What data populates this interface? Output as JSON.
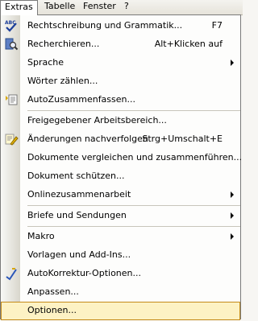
{
  "menubar": {
    "items": [
      "Extras",
      "Tabelle",
      "Fenster",
      "?"
    ]
  },
  "menu": {
    "items": [
      {
        "label": "Rechtschreibung und Grammatik...",
        "shortcut": "F7",
        "icon": "spellcheck-icon"
      },
      {
        "label": "Recherchieren...",
        "shortcut": "Alt+Klicken auf",
        "icon": "research-icon"
      },
      {
        "label": "Sprache",
        "submenu": true
      },
      {
        "label": "Wörter zählen..."
      },
      {
        "label": "AutoZusammenfassen...",
        "icon": "autosummary-icon"
      },
      {
        "separator": true
      },
      {
        "label": "Freigegebener Arbeitsbereich..."
      },
      {
        "label": "Änderungen nachverfolgen",
        "shortcut": "Strg+Umschalt+E",
        "icon": "track-changes-icon"
      },
      {
        "label": "Dokumente vergleichen und zusammenführen..."
      },
      {
        "label": "Dokument schützen..."
      },
      {
        "label": "Onlinezusammenarbeit",
        "submenu": true
      },
      {
        "separator": true
      },
      {
        "label": "Briefe und Sendungen",
        "submenu": true
      },
      {
        "separator": true
      },
      {
        "label": "Makro",
        "submenu": true
      },
      {
        "label": "Vorlagen und Add-Ins..."
      },
      {
        "label": "AutoKorrektur-Optionen...",
        "icon": "autocorrect-icon"
      },
      {
        "label": "Anpassen..."
      },
      {
        "label": "Optionen...",
        "highlighted": true
      }
    ]
  },
  "colors": {
    "highlight_bg": "#fdf2c4",
    "highlight_border": "#c48a18",
    "gutter": "#d8d6cc"
  }
}
